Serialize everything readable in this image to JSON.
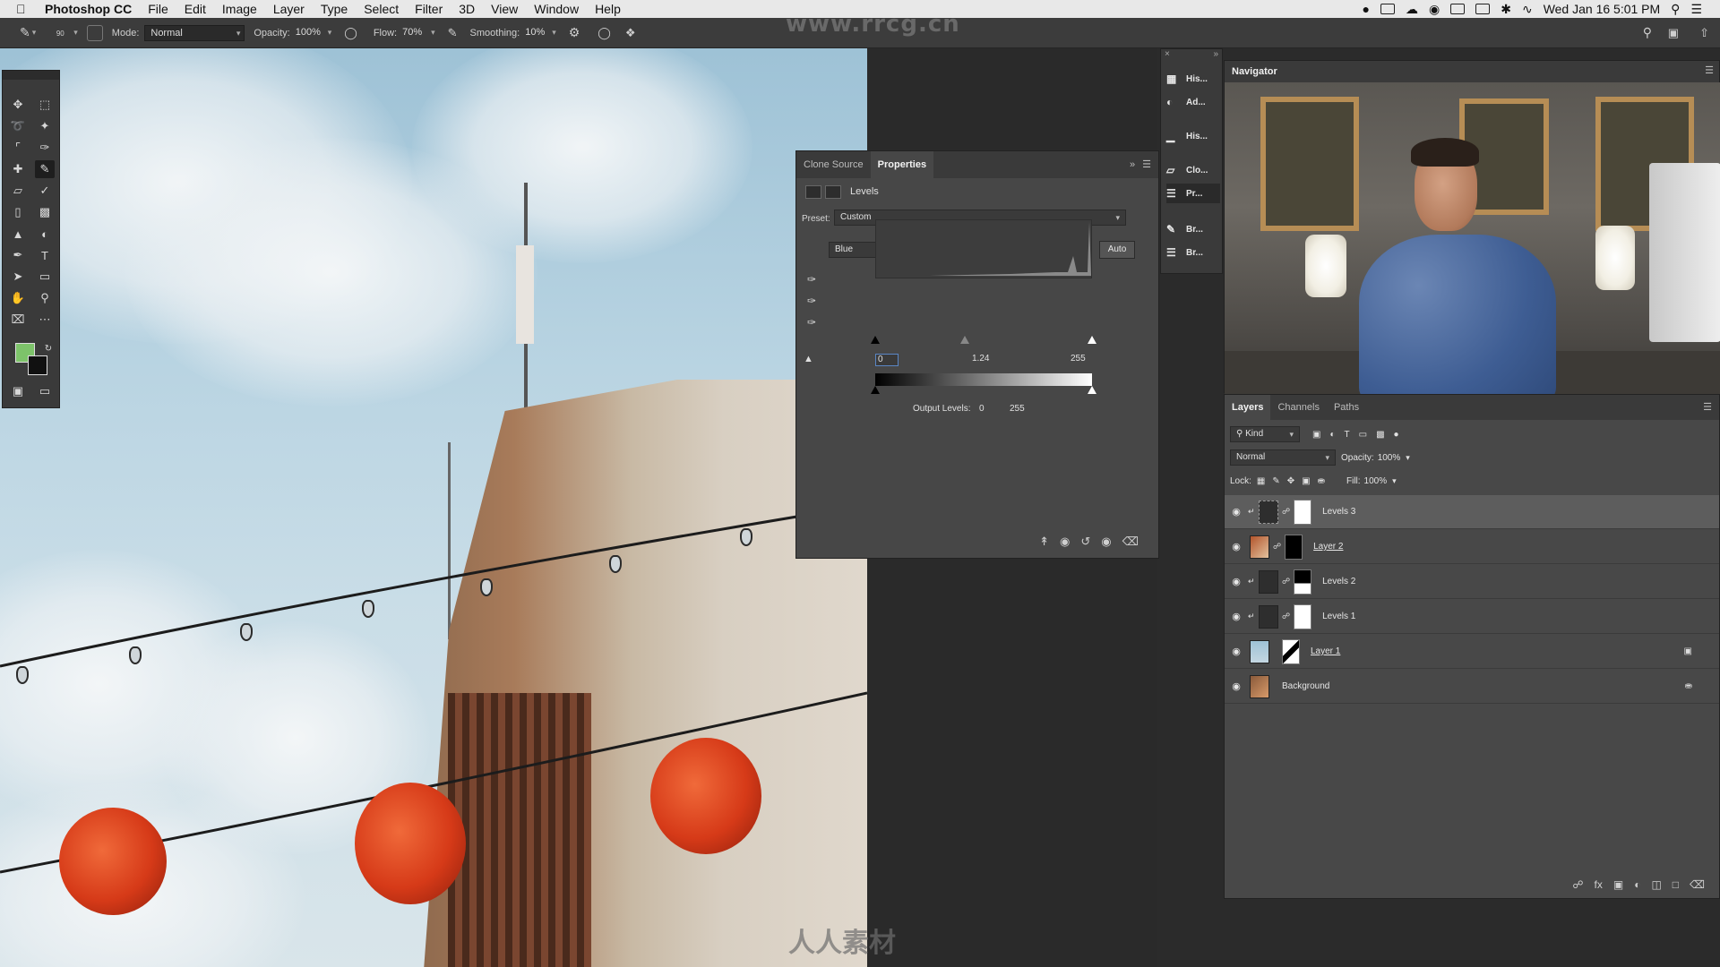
{
  "menubar": {
    "app_name": "Photoshop CC",
    "items": [
      "File",
      "Edit",
      "Image",
      "Layer",
      "Type",
      "Select",
      "Filter",
      "3D",
      "View",
      "Window",
      "Help"
    ],
    "clock": "Wed Jan 16  5:01 PM"
  },
  "options_bar": {
    "brush_size": "90",
    "mode_label": "Mode:",
    "mode_value": "Normal",
    "opacity_label": "Opacity:",
    "opacity_value": "100%",
    "flow_label": "Flow:",
    "flow_value": "70%",
    "smoothing_label": "Smoothing:",
    "smoothing_value": "10%"
  },
  "watermarks": {
    "top": "www.rrcg.cn",
    "bottom": "人人素材"
  },
  "properties_panel": {
    "tabs": [
      "Clone Source",
      "Properties"
    ],
    "active_tab": "Properties",
    "adjustment_name": "Levels",
    "preset_label": "Preset:",
    "preset_value": "Custom",
    "channel_value": "Blue",
    "auto_label": "Auto",
    "input_black": "0",
    "input_gamma": "1.24",
    "input_white": "255",
    "output_label": "Output Levels:",
    "output_black": "0",
    "output_white": "255"
  },
  "mini_panels": {
    "items": [
      "His...",
      "Ad...",
      "His...",
      "Clo...",
      "Pr...",
      "Br...",
      "Br..."
    ]
  },
  "navigator": {
    "title": "Navigator"
  },
  "layers_panel": {
    "tabs": [
      "Layers",
      "Channels",
      "Paths"
    ],
    "active_tab": "Layers",
    "filter_kind": "Kind",
    "blend_mode": "Normal",
    "opacity_label": "Opacity:",
    "opacity_value": "100%",
    "lock_label": "Lock:",
    "fill_label": "Fill:",
    "fill_value": "100%",
    "layers": [
      {
        "name": "Levels 3",
        "selected": true
      },
      {
        "name": "Layer 2",
        "selected": false
      },
      {
        "name": "Levels 2",
        "selected": false
      },
      {
        "name": "Levels 1",
        "selected": false
      },
      {
        "name": "Layer 1",
        "selected": false
      },
      {
        "name": "Background",
        "selected": false
      }
    ]
  },
  "colors": {
    "foreground": "#7dc36a",
    "background": "#111111",
    "panel_bg": "#474747",
    "selected_layer": "#5d5d5d"
  }
}
